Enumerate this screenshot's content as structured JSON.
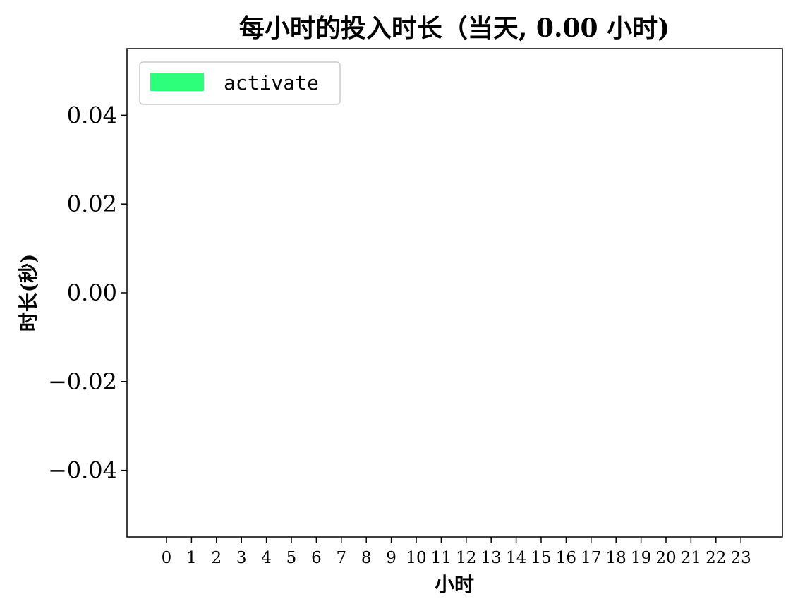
{
  "chart_data": {
    "type": "bar",
    "title": "每小时的投入时长（当天, 0.00 小时)",
    "xlabel": "小时",
    "ylabel": "时长(秒)",
    "categories": [
      "0",
      "1",
      "2",
      "3",
      "4",
      "5",
      "6",
      "7",
      "8",
      "9",
      "10",
      "11",
      "12",
      "13",
      "14",
      "15",
      "16",
      "17",
      "18",
      "19",
      "20",
      "21",
      "22",
      "23"
    ],
    "series": [
      {
        "name": "activate",
        "color": "#2eff7a",
        "values": [
          0,
          0,
          0,
          0,
          0,
          0,
          0,
          0,
          0,
          0,
          0,
          0,
          0,
          0,
          0,
          0,
          0,
          0,
          0,
          0,
          0,
          0,
          0,
          0
        ]
      }
    ],
    "ylim": [
      -0.055,
      0.055
    ],
    "yticks": [
      -0.04,
      -0.02,
      0.0,
      0.02,
      0.04
    ],
    "ytick_labels": [
      "−0.04",
      "−0.02",
      "0.00",
      "0.02",
      "0.04"
    ],
    "grid": false,
    "legend_position": "top-left"
  }
}
